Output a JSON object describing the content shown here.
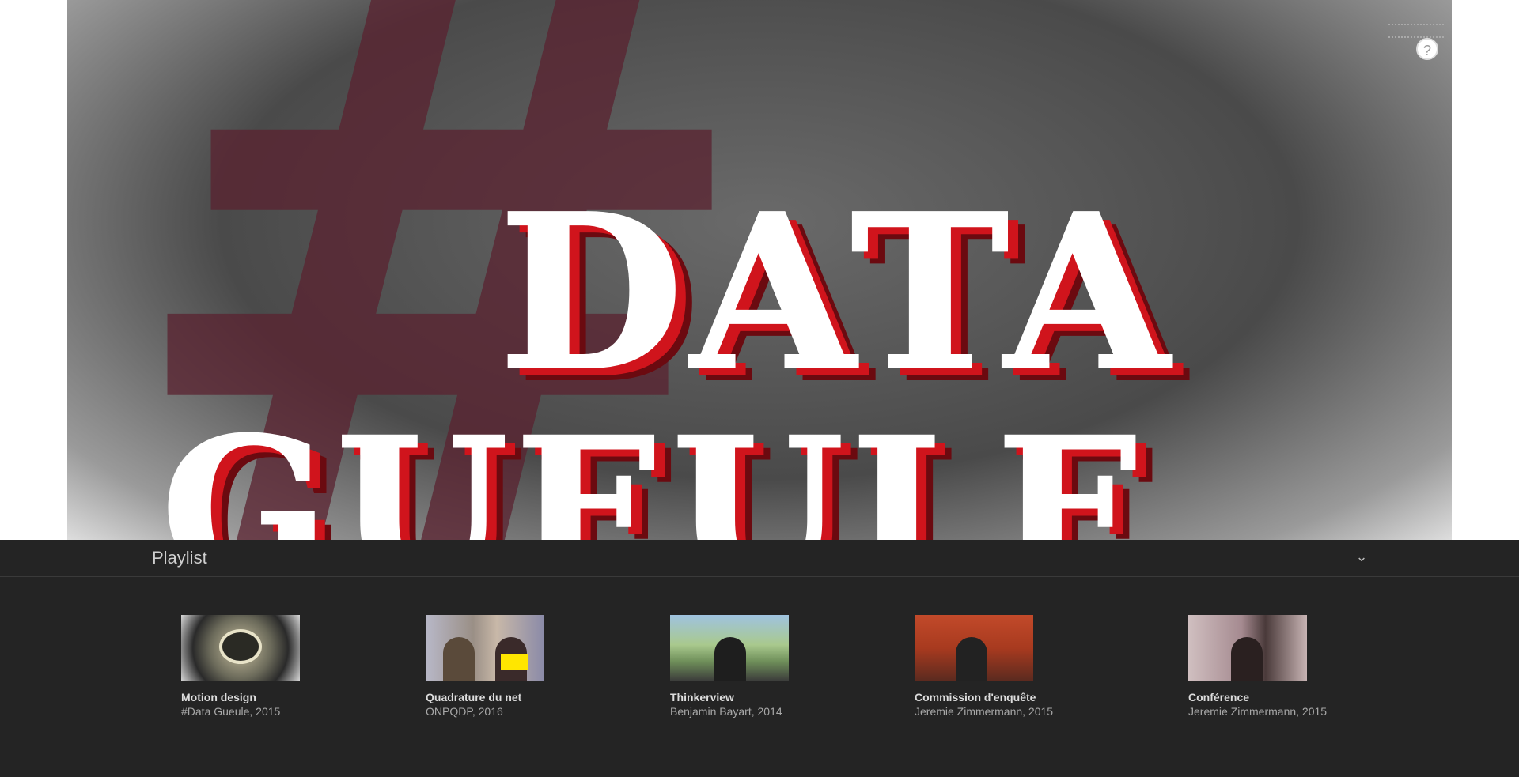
{
  "help": {
    "icon": "question-mark-icon",
    "label": "?"
  },
  "video": {
    "logo_hash": "#",
    "logo_line1": "DATA",
    "logo_line2": "GUEULE"
  },
  "playlist": {
    "title": "Playlist",
    "collapse_icon": "⌄",
    "items": [
      {
        "title": "Motion design",
        "subtitle": "#Data Gueule, 2015",
        "thumbnail": "mouth-graphic"
      },
      {
        "title": "Quadrature du net",
        "subtitle": "ONPQDP, 2016",
        "thumbnail": "two-women-desk"
      },
      {
        "title": "Thinkerview",
        "subtitle": "Benjamin Bayart, 2014",
        "thumbnail": "man-outdoors"
      },
      {
        "title": "Commission d'enquête",
        "subtitle": "Jeremie Zimmermann, 2015",
        "thumbnail": "man-at-bench"
      },
      {
        "title": "Conférence",
        "subtitle": "Jeremie Zimmermann, 2015",
        "thumbnail": "speaker-pointing"
      }
    ]
  }
}
